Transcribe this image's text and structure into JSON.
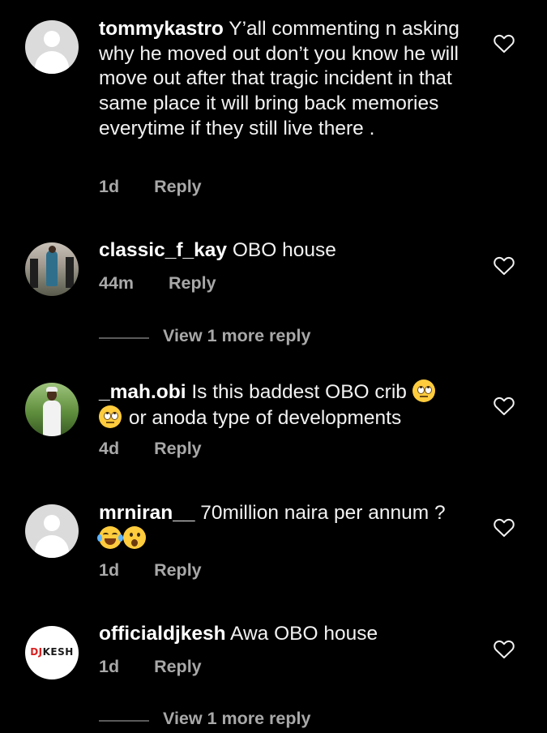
{
  "comments": [
    {
      "username": "tommykastro",
      "text": "Y’all commenting n asking why he moved out don’t you know he will move out after that tragic incident in that same place it will bring back memories everytime if they still live there .",
      "time": "1d",
      "reply_label": "Reply",
      "avatar": "default-avatar"
    },
    {
      "username": "classic_f_kay",
      "text": "OBO house",
      "time": "44m",
      "reply_label": "Reply",
      "avatar": "photo-avatar",
      "view_more": "View 1 more reply"
    },
    {
      "username": "_mah.obi",
      "text_before": "Is this baddest OBO crib",
      "text_after": "or anoda type of developments",
      "emojis": [
        "face-with-rolling-eyes",
        "face-with-rolling-eyes"
      ],
      "time": "4d",
      "reply_label": "Reply",
      "avatar": "photo-avatar"
    },
    {
      "username": "mrniran__",
      "text": "70million naira per annum ?",
      "emojis": [
        "face-with-tears-of-joy",
        "face-with-open-mouth"
      ],
      "time": "1d",
      "reply_label": "Reply",
      "avatar": "default-avatar"
    },
    {
      "username": "officialdjkesh",
      "text": "Awa OBO house",
      "time": "1d",
      "reply_label": "Reply",
      "avatar": "logo-avatar",
      "avatar_logo_text": "DJ KESH",
      "view_more": "View 1 more reply"
    }
  ],
  "icons": {
    "like": "heart-outline-icon"
  },
  "colors": {
    "background": "#000000",
    "text": "#f2f2f2",
    "secondary_text": "#a8a8a8",
    "divider": "#5a5a5a"
  }
}
